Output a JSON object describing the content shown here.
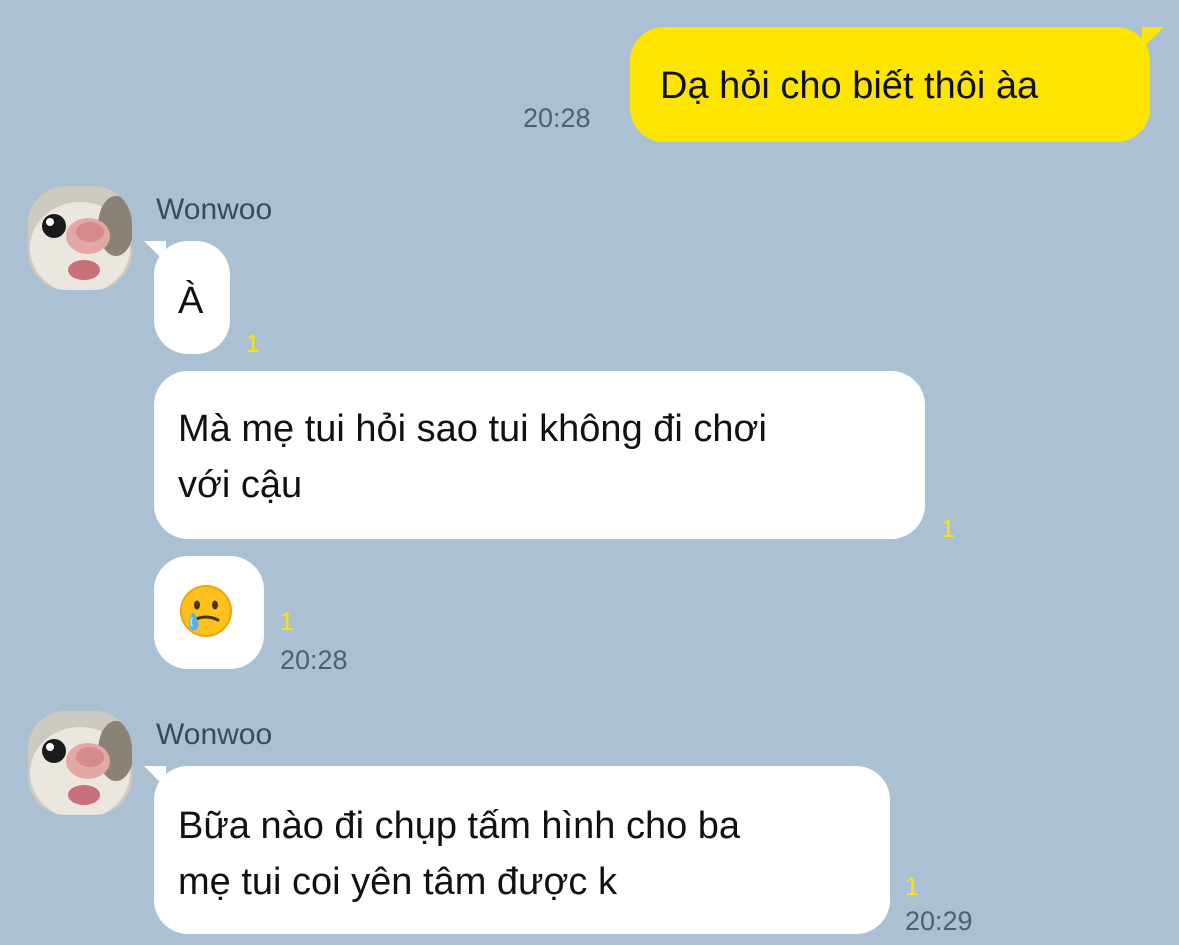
{
  "messages": {
    "out_1": {
      "text": "Dạ hỏi cho biết thôi àa",
      "time": "20:28"
    },
    "group_1": {
      "sender": "Wonwoo",
      "msg_1": {
        "text": "À",
        "unread": "1"
      },
      "msg_2": {
        "line1": "Mà mẹ tui hỏi sao tui không đi chơi",
        "line2": "với cậu",
        "unread": "1"
      },
      "msg_3": {
        "emoji": "tearful-smile-emoji",
        "unread": "1",
        "time": "20:28"
      }
    },
    "group_2": {
      "sender": "Wonwoo",
      "msg_1": {
        "line1": "Bữa nào đi chụp tấm hình cho ba",
        "line2": "mẹ tui coi yên tâm được k",
        "unread": "1",
        "time": "20:29"
      }
    }
  },
  "colors": {
    "background": "#abc1d3",
    "outgoing_bubble": "#fee500",
    "incoming_bubble": "#ffffff",
    "unread_count": "#fee500",
    "timestamp": "#4f5f6e"
  }
}
